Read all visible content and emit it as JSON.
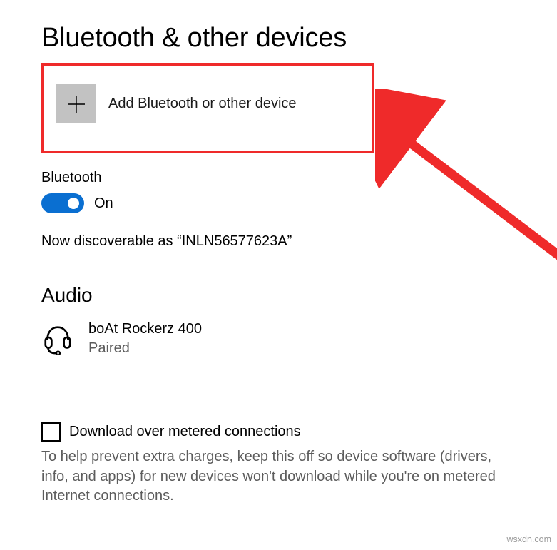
{
  "header": {
    "title": "Bluetooth & other devices"
  },
  "add_device": {
    "label": "Add Bluetooth or other device"
  },
  "bluetooth": {
    "label": "Bluetooth",
    "toggle_state": "On",
    "discoverable": "Now discoverable as “INLN56577623A”"
  },
  "audio": {
    "heading": "Audio",
    "devices": [
      {
        "name": "boAt Rockerz 400",
        "status": "Paired"
      }
    ]
  },
  "metered": {
    "checkbox_label": "Download over metered connections",
    "description": "To help prevent extra charges, keep this off so device software (drivers, info, and apps) for new devices won't download while you're on metered Internet connections."
  },
  "watermark": "wsxdn.com",
  "colors": {
    "annotation_red": "#ef2a2a",
    "toggle_blue": "#0a6fd1"
  }
}
